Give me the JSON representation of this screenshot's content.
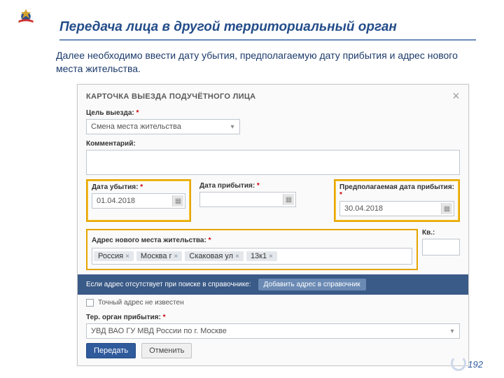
{
  "page_number": "192",
  "header": {
    "title": "Передача лица в другой территориальный орган"
  },
  "intro_text": "Далее необходимо ввести дату убытия, предполагаемую дату прибытия и адрес нового места жительства.",
  "card": {
    "title": "КАРТОЧКА ВЫЕЗДА ПОДУЧЁТНОГО ЛИЦА",
    "purpose_label": "Цель выезда:",
    "purpose_value": "Смена места жительства",
    "comment_label": "Комментарий:",
    "date_depart_label": "Дата убытия:",
    "date_depart_value": "01.04.2018",
    "date_arrive_label": "Дата прибытия:",
    "date_arrive_value": "",
    "date_expected_label": "Предполагаемая дата прибытия:",
    "date_expected_value": "30.04.2018",
    "address_label": "Адрес нового места жительства:",
    "chips": [
      "Россия",
      "Москва г",
      "Скаковая ул",
      "13к1"
    ],
    "kv_label": "Кв.:",
    "bluebar_text": "Если адрес отсутствует при поиске в справочнике:",
    "bluebar_button": "Добавить адрес в справочник",
    "exact_unknown_label": "Точный адрес не известен",
    "ter_label": "Тер. орган прибытия:",
    "ter_value": "УВД ВАО ГУ МВД России по г. Москве",
    "submit": "Передать",
    "cancel": "Отменить"
  }
}
